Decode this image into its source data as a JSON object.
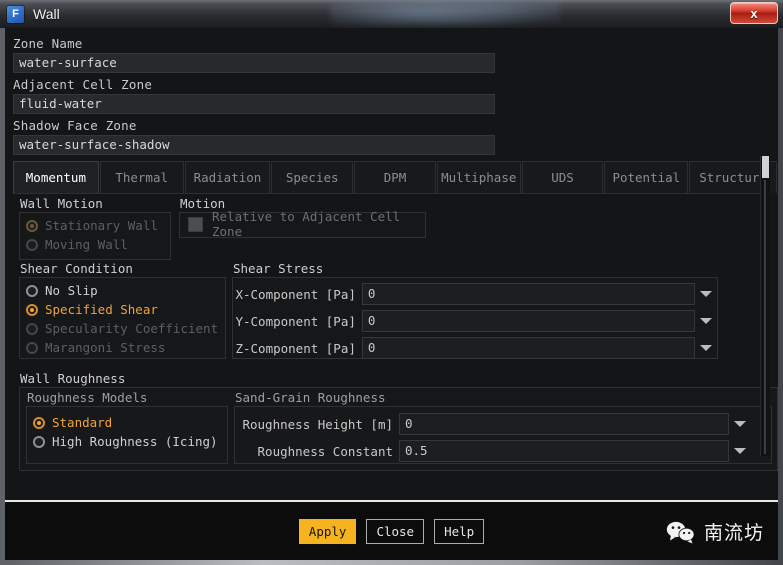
{
  "window": {
    "title": "Wall",
    "app_icon": "fluent-f-icon",
    "close_label": "x"
  },
  "zone": {
    "name_label": "Zone Name",
    "name_value": "water-surface",
    "adjacent_label": "Adjacent Cell Zone",
    "adjacent_value": "fluid-water",
    "shadow_label": "Shadow Face Zone",
    "shadow_value": "water-surface-shadow"
  },
  "tabs": [
    {
      "label": "Momentum",
      "active": true
    },
    {
      "label": "Thermal",
      "active": false
    },
    {
      "label": "Radiation",
      "active": false
    },
    {
      "label": "Species",
      "active": false
    },
    {
      "label": "DPM",
      "active": false
    },
    {
      "label": "Multiphase",
      "active": false
    },
    {
      "label": "UDS",
      "active": false
    },
    {
      "label": "Potential",
      "active": false
    },
    {
      "label": "Structure",
      "active": false
    }
  ],
  "wall_motion": {
    "title": "Wall Motion",
    "options": [
      {
        "label": "Stationary Wall",
        "checked": true,
        "disabled": true
      },
      {
        "label": "Moving Wall",
        "checked": false,
        "disabled": true
      }
    ]
  },
  "motion": {
    "title": "Motion",
    "checkbox_label": "Relative to Adjacent Cell Zone",
    "checked": false,
    "disabled": true
  },
  "shear_condition": {
    "title": "Shear Condition",
    "options": [
      {
        "label": "No Slip",
        "checked": false,
        "disabled": false
      },
      {
        "label": "Specified Shear",
        "checked": true,
        "disabled": false
      },
      {
        "label": "Specularity Coefficient",
        "checked": false,
        "disabled": true
      },
      {
        "label": "Marangoni Stress",
        "checked": false,
        "disabled": true
      }
    ]
  },
  "shear_stress": {
    "title": "Shear Stress",
    "rows": [
      {
        "label": "X-Component [Pa]",
        "value": "0"
      },
      {
        "label": "Y-Component [Pa]",
        "value": "0"
      },
      {
        "label": "Z-Component [Pa]",
        "value": "0"
      }
    ]
  },
  "wall_roughness": {
    "title": "Wall Roughness",
    "models_title": "Roughness Models",
    "options": [
      {
        "label": "Standard",
        "checked": true,
        "disabled": false
      },
      {
        "label": "High Roughness (Icing)",
        "checked": false,
        "disabled": false
      }
    ]
  },
  "sand_grain": {
    "title": "Sand-Grain Roughness",
    "rows": [
      {
        "label": "Roughness Height [m]",
        "value": "0"
      },
      {
        "label": "Roughness Constant",
        "value": "0.5"
      }
    ]
  },
  "buttons": {
    "apply": "Apply",
    "close": "Close",
    "help": "Help"
  },
  "watermark": {
    "icon": "wechat-icon",
    "text": "南流坊"
  },
  "colors": {
    "accent": "#f0a33a",
    "apply_bg": "#f5b41f",
    "close_btn": "#d84030",
    "panel_bg": "#141517",
    "text": "#cfcfcf"
  }
}
